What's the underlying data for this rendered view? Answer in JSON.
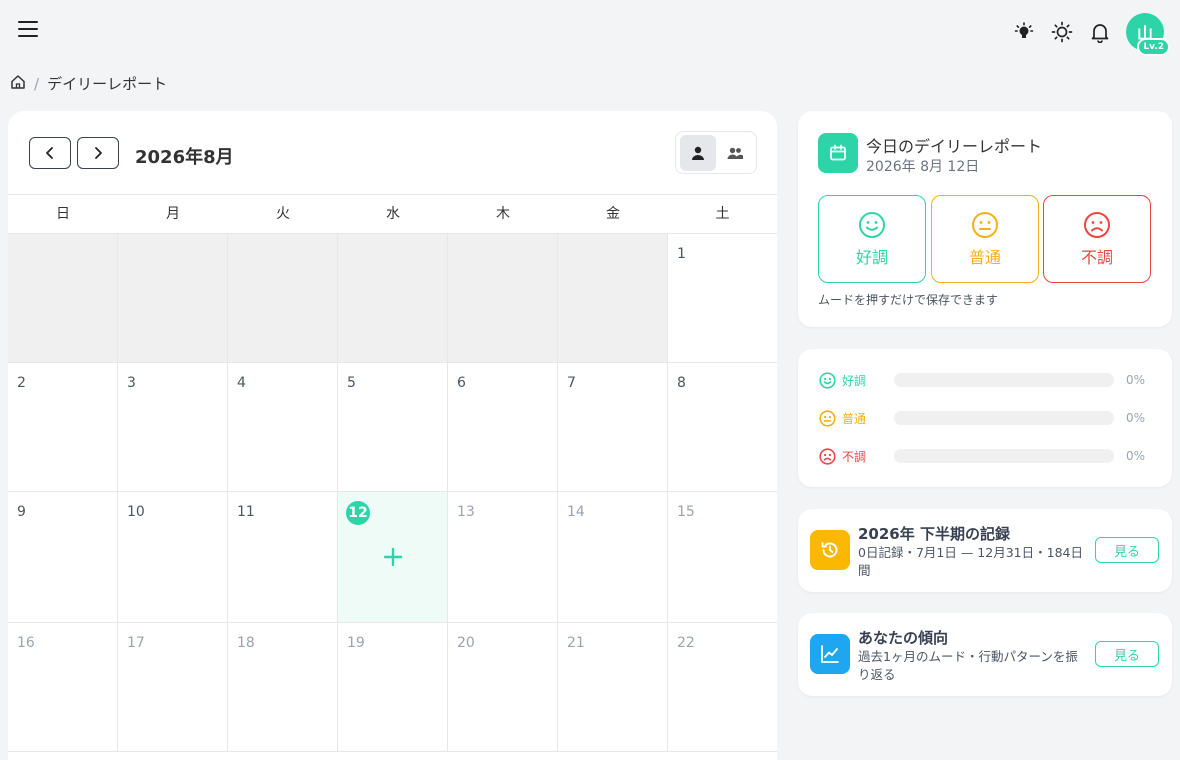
{
  "header": {
    "avatar_initial": "山",
    "level_badge": "Lv.2"
  },
  "breadcrumb": {
    "separator": "/",
    "current": "デイリーレポート"
  },
  "calendar": {
    "month_title": "2026年8月",
    "weekdays": [
      "日",
      "月",
      "火",
      "水",
      "木",
      "金",
      "土"
    ],
    "weeks": [
      [
        "",
        "",
        "",
        "",
        "",
        "",
        "1"
      ],
      [
        "2",
        "3",
        "4",
        "5",
        "6",
        "7",
        "8"
      ],
      [
        "9",
        "10",
        "11",
        "12",
        "13",
        "14",
        "15"
      ],
      [
        "16",
        "17",
        "18",
        "19",
        "20",
        "21",
        "22"
      ]
    ],
    "today": "12"
  },
  "report": {
    "title": "今日のデイリーレポート",
    "date": "2026年 8月 12日",
    "moods": [
      {
        "label": "好調",
        "color": "#2dd4a7"
      },
      {
        "label": "普通",
        "color": "#f5b014"
      },
      {
        "label": "不調",
        "color": "#ef4444"
      }
    ],
    "hint": "ムードを押すだけで保存できます"
  },
  "stats": [
    {
      "label": "好調",
      "percent": "0%",
      "value": 0,
      "color": "#2dd4a7"
    },
    {
      "label": "普通",
      "percent": "0%",
      "value": 0,
      "color": "#f5b014"
    },
    {
      "label": "不調",
      "percent": "0%",
      "value": 0,
      "color": "#ef4444"
    }
  ],
  "record_card": {
    "title": "2026年 下半期の記録",
    "desc": "0日記録・7月1日 — 12月31日・184日間",
    "button": "見る",
    "icon_color": "#fbb800"
  },
  "trend_card": {
    "title": "あなたの傾向",
    "desc": "過去1ヶ月のムード・行動パターンを振り返る",
    "button": "見る",
    "icon_color": "#1ea7f0"
  },
  "colors": {
    "accent": "#2dd4a7",
    "neutral": "#f5b014",
    "bad": "#ef4444"
  }
}
